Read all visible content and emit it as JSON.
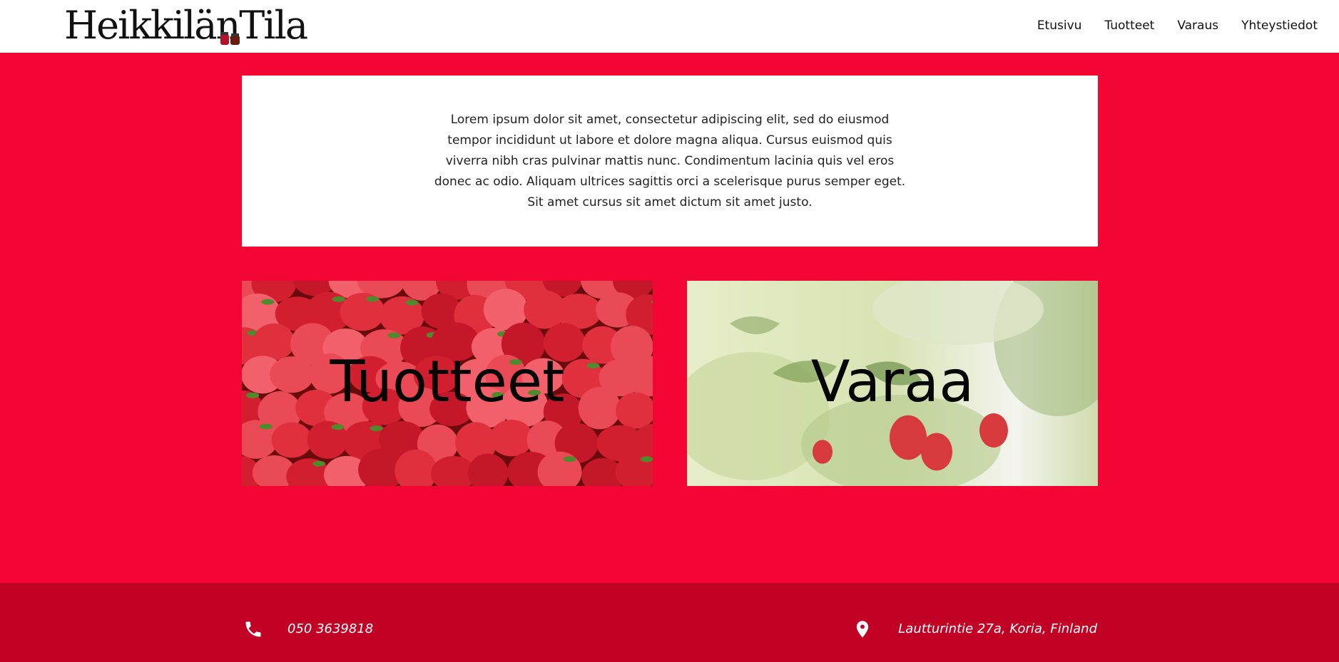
{
  "header": {
    "logo_text": "HeikkilänTila",
    "nav": [
      {
        "label": "Etusivu"
      },
      {
        "label": "Tuotteet"
      },
      {
        "label": "Varaus"
      },
      {
        "label": "Yhteystiedot"
      }
    ]
  },
  "intro": {
    "text": "Lorem ipsum dolor sit amet, consectetur adipiscing elit, sed do eiusmod tempor incididunt ut labore et dolore magna aliqua. Cursus euismod quis viverra nibh cras pulvinar mattis nunc. Condimentum lacinia quis vel eros donec ac odio. Aliquam ultrices sagittis orci a scelerisque purus semper eget. Sit amet cursus sit amet dictum sit amet justo."
  },
  "cards": {
    "products": {
      "label": "Tuotteet",
      "image": "strawberries-photo"
    },
    "booking": {
      "label": "Varaa",
      "image": "strawberry-plant-photo"
    }
  },
  "footer": {
    "phone": "050 3639818",
    "phone_icon": "phone-icon",
    "address": "Lautturintie 27a, Koria, Finland",
    "address_icon": "location-pin-icon"
  },
  "colors": {
    "page_bg": "#f30534",
    "footer_bg": "#c20224",
    "box_bg": "#ffffff"
  }
}
